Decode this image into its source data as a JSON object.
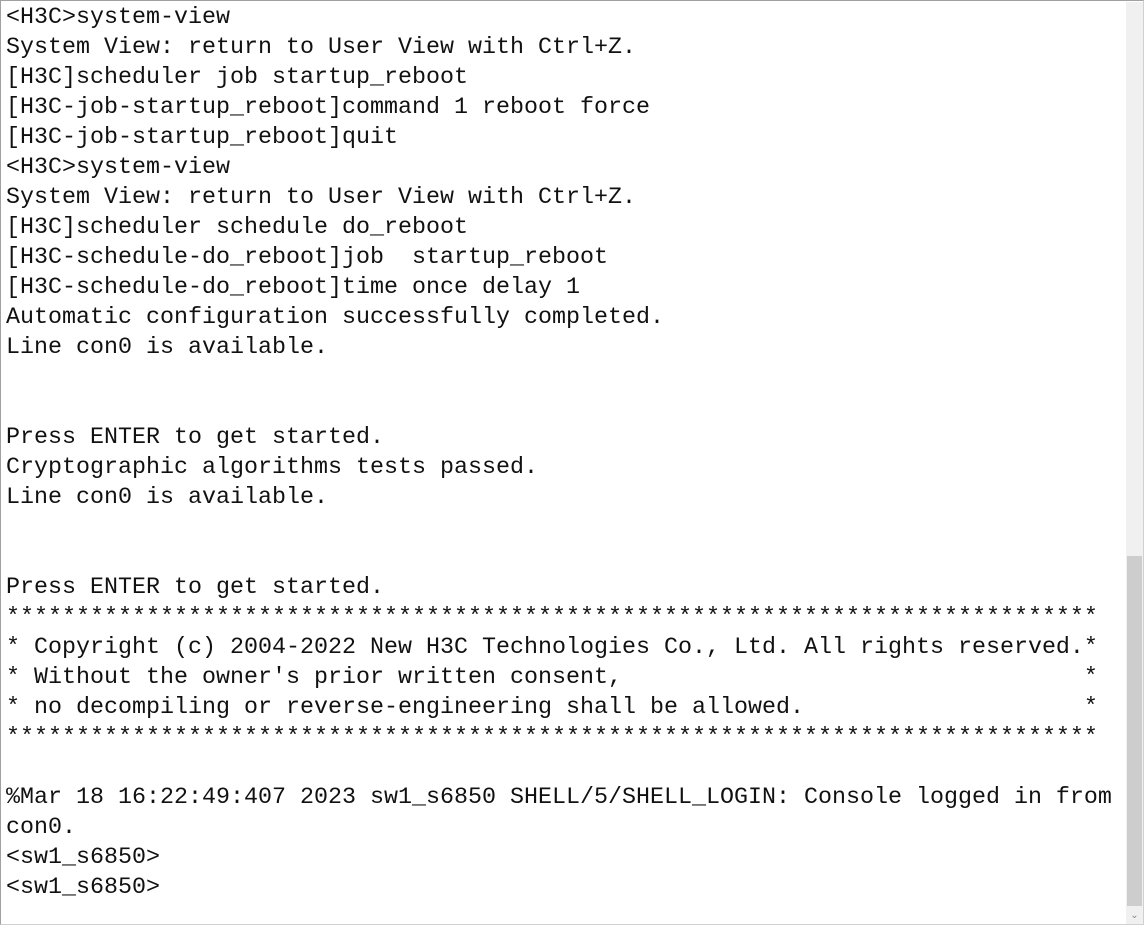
{
  "terminal": {
    "lines": [
      "<H3C>system-view",
      "System View: return to User View with Ctrl+Z.",
      "[H3C]scheduler job startup_reboot",
      "[H3C-job-startup_reboot]command 1 reboot force",
      "[H3C-job-startup_reboot]quit",
      "<H3C>system-view",
      "System View: return to User View with Ctrl+Z.",
      "[H3C]scheduler schedule do_reboot",
      "[H3C-schedule-do_reboot]job  startup_reboot",
      "[H3C-schedule-do_reboot]time once delay 1",
      "Automatic configuration successfully completed.",
      "Line con0 is available.",
      "",
      "",
      "Press ENTER to get started.",
      "Cryptographic algorithms tests passed.",
      "Line con0 is available.",
      "",
      "",
      "Press ENTER to get started.",
      "******************************************************************************",
      "* Copyright (c) 2004-2022 New H3C Technologies Co., Ltd. All rights reserved.*",
      "* Without the owner's prior written consent,                                 *",
      "* no decompiling or reverse-engineering shall be allowed.                    *",
      "******************************************************************************",
      "",
      "%Mar 18 16:22:49:407 2023 sw1_s6850 SHELL/5/SHELL_LOGIN: Console logged in from",
      "con0.",
      "<sw1_s6850>",
      "<sw1_s6850>"
    ]
  },
  "scrollbar": {
    "position_percent": 100,
    "down_arrow_icon": "chevron-down-icon"
  }
}
